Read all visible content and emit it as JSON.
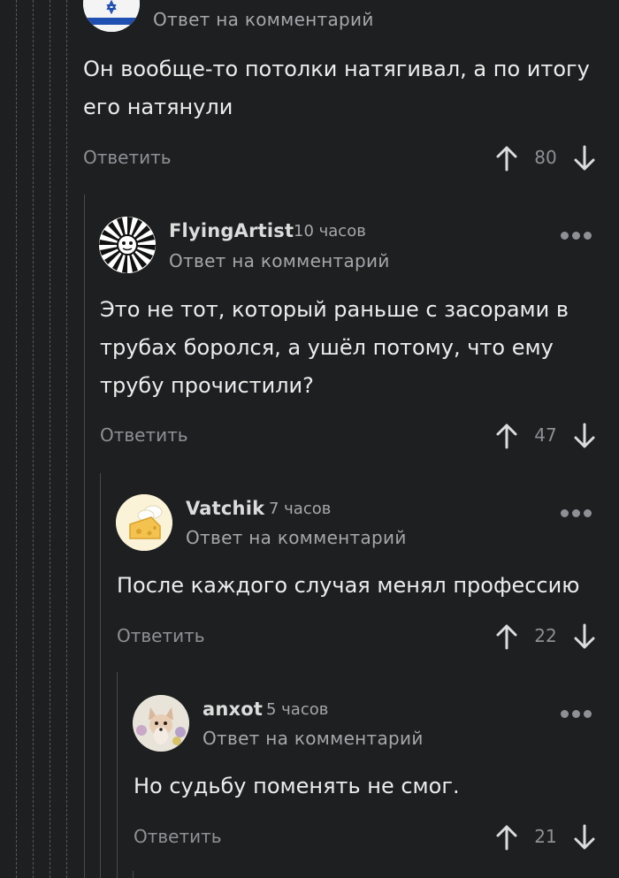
{
  "comments": [
    {
      "author": "",
      "time": "",
      "reply_to": "Ответ на комментарий",
      "body": "Он вообще-то потолки натягивал, а по итогу его натянули",
      "reply_label": "Ответить",
      "score": "80"
    },
    {
      "author": "FlyingArtist",
      "time": "10 часов",
      "reply_to": "Ответ на комментарий",
      "body": "Это не тот, который раньше с засорами в трубах боролся, а ушёл потому, что ему трубу прочистили?",
      "reply_label": "Ответить",
      "score": "47"
    },
    {
      "author": "Vatchik",
      "time": "7 часов",
      "reply_to": "Ответ на комментарий",
      "body": "После каждого случая менял профессию",
      "reply_label": "Ответить",
      "score": "22"
    },
    {
      "author": "anxot",
      "time": "5 часов",
      "reply_to": "Ответ на комментарий",
      "body": "Но судьбу поменять не смог.",
      "reply_label": "Ответить",
      "score": "21"
    }
  ],
  "icons": {
    "upvote": "arrow-up-icon",
    "downvote": "arrow-down-icon",
    "more": "more-dots-icon"
  },
  "colors": {
    "background": "#1e1f21",
    "text": "#ececec",
    "muted": "#8d9094",
    "thread_line": "#55585c"
  }
}
